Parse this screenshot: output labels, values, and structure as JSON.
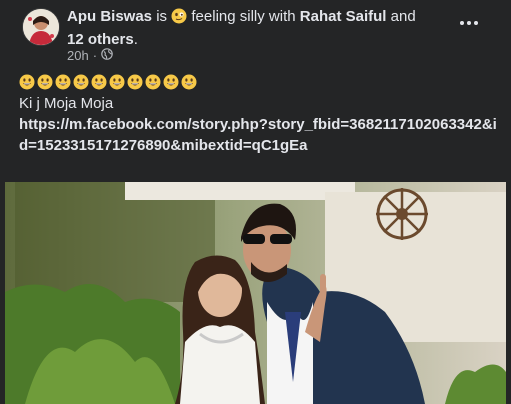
{
  "post": {
    "author": "Apu Biswas",
    "connector_is": "is",
    "feeling_text": "feeling silly with",
    "tagged_friend": "Rahat Saiful",
    "connector_and": "and",
    "others": "12 others",
    "period": ".",
    "time": "20h",
    "separator": "·",
    "audience_icon": "globe-icon",
    "emoji_icon": "grinning-face-icon",
    "emoji_count": 10,
    "text_line1": "Ki j Moja Moja",
    "link": "https://m.facebook.com/story.php?story_fbid=3682117102063342&id=1523315171276890&mibextid=qC1gEa"
  },
  "colors": {
    "background": "#242526",
    "text_primary": "#e4e6eb",
    "text_secondary": "#b0b3b8",
    "emoji_yellow": "#f7c948"
  }
}
